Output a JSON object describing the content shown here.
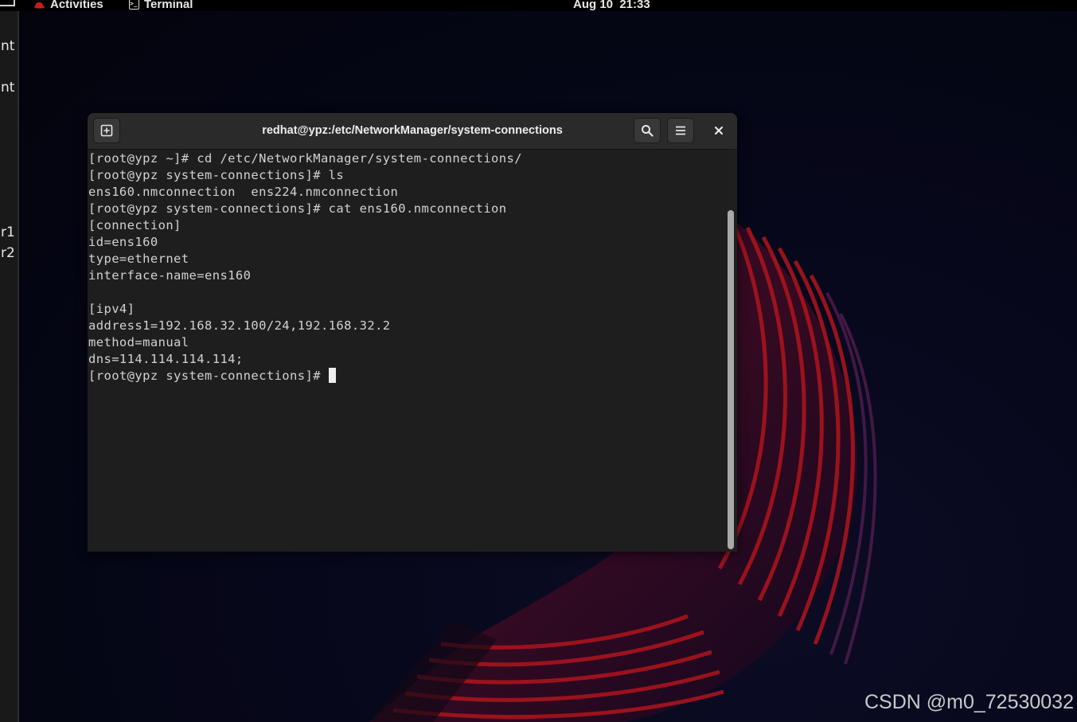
{
  "topbar": {
    "activities": "Activities",
    "app_name": "Terminal",
    "clock": "Aug 10  21:33"
  },
  "left_edge_fragments": [
    "nt",
    "nt",
    "r1",
    "r2"
  ],
  "terminal": {
    "title": "redhat@ypz:/etc/NetworkManager/system-connections",
    "new_tab_icon": "new-tab-icon",
    "search_icon": "search-icon",
    "menu_icon": "hamburger-menu-icon",
    "close_icon": "close-icon",
    "lines": [
      "[root@ypz ~]# cd /etc/NetworkManager/system-connections/",
      "[root@ypz system-connections]# ls",
      "ens160.nmconnection  ens224.nmconnection",
      "[root@ypz system-connections]# cat ens160.nmconnection",
      "[connection]",
      "id=ens160",
      "type=ethernet",
      "interface-name=ens160",
      "",
      "[ipv4]",
      "address1=192.168.32.100/24,192.168.32.2",
      "method=manual",
      "dns=114.114.114.114;"
    ],
    "prompt": "[root@ypz system-connections]# "
  },
  "watermark": "CSDN @m0_72530032",
  "colors": {
    "accent_red": "#cc1a1a",
    "terminal_bg": "#1e1e1e",
    "headerbar_bg": "#2a2a2a"
  }
}
